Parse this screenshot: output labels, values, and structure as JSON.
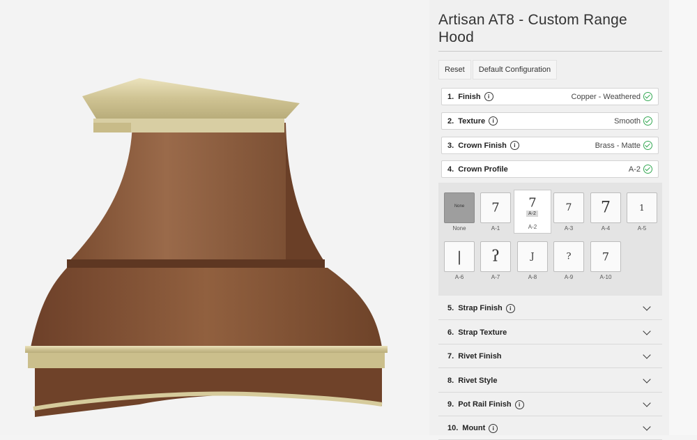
{
  "product": {
    "title": "Artisan AT8 - Custom Range Hood"
  },
  "actions": {
    "reset": "Reset",
    "default_config": "Default Configuration"
  },
  "steps": [
    {
      "num": "1.",
      "label": "Finish",
      "value": "Copper - Weathered",
      "info": true
    },
    {
      "num": "2.",
      "label": "Texture",
      "value": "Smooth",
      "info": true
    },
    {
      "num": "3.",
      "label": "Crown Finish",
      "value": "Brass - Matte",
      "info": true
    },
    {
      "num": "4.",
      "label": "Crown Profile",
      "value": "A-2",
      "info": false
    }
  ],
  "profiles": {
    "selected": "A-2",
    "none_box_text": "None",
    "tooltip": "A-2",
    "options": [
      "None",
      "A-1",
      "A-2",
      "A-3",
      "A-4",
      "A-5",
      "A-6",
      "A-7",
      "A-8",
      "A-9",
      "A-10"
    ]
  },
  "accordion": [
    {
      "num": "5.",
      "label": "Strap Finish",
      "info": true
    },
    {
      "num": "6.",
      "label": "Strap Texture",
      "info": false
    },
    {
      "num": "7.",
      "label": "Rivet Finish",
      "info": false
    },
    {
      "num": "8.",
      "label": "Rivet Style",
      "info": false
    },
    {
      "num": "9.",
      "label": "Pot Rail Finish",
      "info": true
    },
    {
      "num": "10.",
      "label": "Mount",
      "info": true
    }
  ],
  "colors": {
    "copper": "#8a5a3a",
    "brass": "#d9cfa4",
    "success": "#34a853"
  },
  "icons": {
    "info": "info-circle-icon",
    "check": "check-circle-icon",
    "chevron": "chevron-down-icon"
  }
}
